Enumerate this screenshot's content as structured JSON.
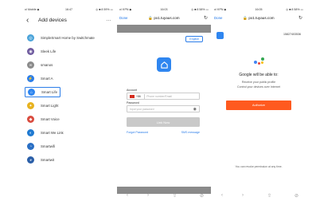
{
  "phone1": {
    "status": {
      "left": "•ıl Mobile ◆",
      "center": "16:47",
      "right": "◎ ■ 8 59% ▭"
    },
    "title": "Add devices",
    "more": "…",
    "items": [
      {
        "name": "SimpleSmart Home by Switchmate",
        "icon": "switchmate-icon",
        "color": "#4aa3d9",
        "glyph": "◎"
      },
      {
        "name": "Sleek Life",
        "icon": "sleek-life-icon",
        "color": "#6e5a9e",
        "glyph": "◉"
      },
      {
        "name": "smanos",
        "icon": "smanos-icon",
        "color": "#8b8b8b",
        "glyph": "∞"
      },
      {
        "name": "Smart A",
        "icon": "smart-a-icon",
        "color": "#2b7de9",
        "glyph": "⚡"
      },
      {
        "name": "Smart Life",
        "icon": "smart-life-icon",
        "color": "#2f86f0",
        "glyph": "⌂",
        "selected": true
      },
      {
        "name": "Smart Light",
        "icon": "smart-light-icon",
        "color": "#e7b21e",
        "glyph": "✦"
      },
      {
        "name": "Smart Voice",
        "icon": "smart-voice-icon",
        "color": "#d94b3e",
        "glyph": "◆"
      },
      {
        "name": "Smart We Link",
        "icon": "smart-we-link-icon",
        "color": "#1f7ad1",
        "glyph": "◐"
      },
      {
        "name": "Smartwifi",
        "icon": "smartwifi-icon",
        "color": "#2a6fc4",
        "glyph": "◔"
      },
      {
        "name": "Smartwit",
        "icon": "smartwit-icon",
        "color": "#2b5fa8",
        "glyph": "◕"
      }
    ]
  },
  "phone2": {
    "status": {
      "left": "•ıl KPN ◆",
      "center": "16:03",
      "right": "◎ ■ 8 58% ▭"
    },
    "done": "Done",
    "url": "🔒 px1.tuyaus.com",
    "reload": "↻",
    "lang": "English",
    "account_label": "Account",
    "country_code": "+86",
    "phone_placeholder": "Phone number/Email",
    "password_label": "Password",
    "password_placeholder": "Input your password",
    "eye": "◉",
    "login": "Link Now",
    "forgot": "Forgot Password",
    "sms": "SMS message",
    "toolbar": [
      "‹",
      "›",
      "⇧",
      "⊘"
    ]
  },
  "phone3": {
    "status": {
      "left": "•ıl KPN ◆",
      "center": "16:05",
      "right": "◎ ■ 8 58% ▭"
    },
    "done": "Done",
    "url": "🔒 px1.tuyaus.com",
    "reload": "↻",
    "account": "15827403536",
    "google_title": "Google will be able to:",
    "line1": "Receive your public profile",
    "line2": "Control your devices over Internet",
    "authorize": "Authorize",
    "revoke": "You can revoke permission at any time.",
    "toolbar": [
      "‹",
      "›",
      "⇧",
      "⊘"
    ],
    "colors": {
      "blue": "#4285f4",
      "red": "#ea4335",
      "yellow": "#fbbc05",
      "green": "#34a853"
    }
  }
}
